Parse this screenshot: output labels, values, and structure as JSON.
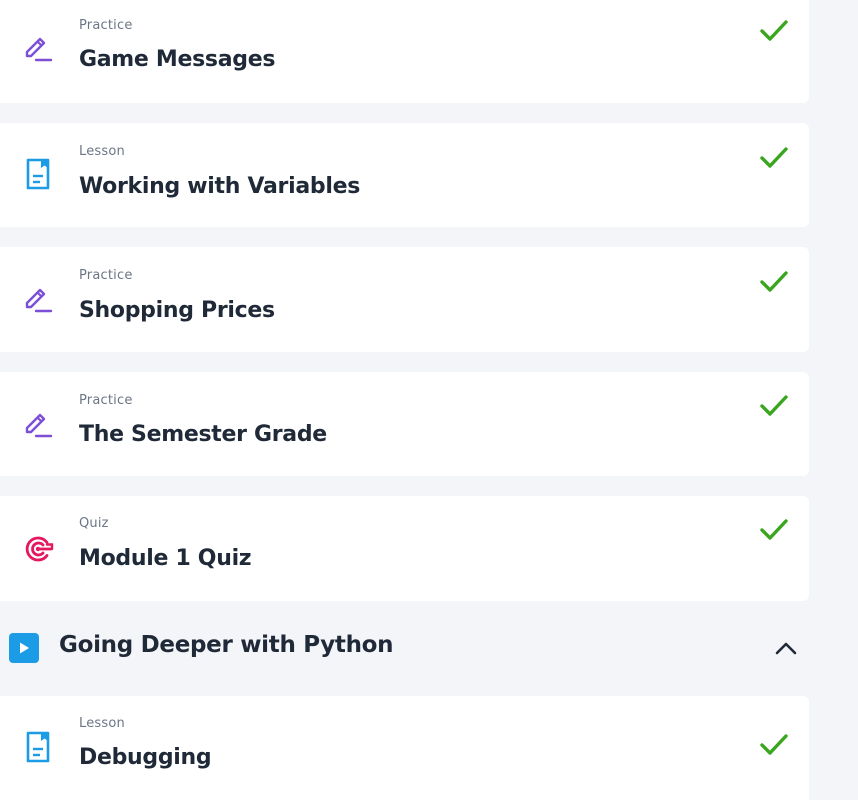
{
  "items": [
    {
      "type": "Practice",
      "title": "Game Messages",
      "icon": "pencil-icon",
      "status": "completed"
    },
    {
      "type": "Lesson",
      "title": "Working with Variables",
      "icon": "lesson-document-icon",
      "status": "completed"
    },
    {
      "type": "Practice",
      "title": "Shopping Prices",
      "icon": "pencil-icon",
      "status": "completed"
    },
    {
      "type": "Practice",
      "title": "The Semester Grade",
      "icon": "pencil-icon",
      "status": "completed"
    },
    {
      "type": "Quiz",
      "title": "Module 1 Quiz",
      "icon": "target-icon",
      "status": "completed"
    }
  ],
  "section": {
    "title": "Going Deeper with Python",
    "icon": "play-icon",
    "expanded": true
  },
  "section_items": [
    {
      "type": "Lesson",
      "title": "Debugging",
      "icon": "lesson-document-icon",
      "status": "completed"
    }
  ],
  "colors": {
    "practice_icon": "#7c4fd6",
    "lesson_icon": "#1c9be6",
    "quiz_icon": "#e5175f",
    "check": "#3aa51f",
    "background": "#f3f5f8"
  }
}
